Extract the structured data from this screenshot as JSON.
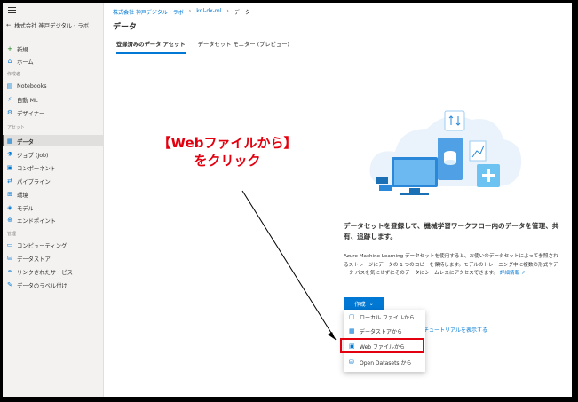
{
  "workspace": {
    "name": "株式会社 神戸デジタル・ラボ"
  },
  "sidebar": {
    "items_top": [
      {
        "label": "新規",
        "icon": "plus-icon"
      },
      {
        "label": "ホーム",
        "icon": "home-icon"
      }
    ],
    "section_author": "作成者",
    "items_author": [
      {
        "label": "Notebooks",
        "icon": "notebook-icon"
      },
      {
        "label": "自動 ML",
        "icon": "automl-icon"
      },
      {
        "label": "デザイナー",
        "icon": "designer-icon"
      }
    ],
    "section_assets": "アセット",
    "items_assets": [
      {
        "label": "データ",
        "icon": "data-icon"
      },
      {
        "label": "ジョブ (Job)",
        "icon": "job-icon"
      },
      {
        "label": "コンポーネント",
        "icon": "component-icon"
      },
      {
        "label": "パイプライン",
        "icon": "pipeline-icon"
      },
      {
        "label": "環境",
        "icon": "environment-icon"
      },
      {
        "label": "モデル",
        "icon": "model-icon"
      },
      {
        "label": "エンドポイント",
        "icon": "endpoint-icon"
      }
    ],
    "section_manage": "管理",
    "items_manage": [
      {
        "label": "コンピューティング",
        "icon": "compute-icon"
      },
      {
        "label": "データストア",
        "icon": "datastore-icon"
      },
      {
        "label": "リンクされたサービス",
        "icon": "linked-service-icon"
      },
      {
        "label": "データのラベル付け",
        "icon": "labeling-icon"
      }
    ]
  },
  "breadcrumb": [
    "株式会社 神戸デジタル・ラボ",
    "kdl-dx-ml",
    "データ"
  ],
  "page": {
    "title": "データ"
  },
  "tabs": [
    "登録済みのデータ アセット",
    "データセット モニター (プレビュー)"
  ],
  "annotation": {
    "line1": "【Webファイルから】",
    "line2": "をクリック"
  },
  "empty_state": {
    "title": "データセットを登録して、機械学習ワークフロー内のデータを管理、共有、追跡します。",
    "description": "Azure Machine Learning データセットを使用すると、お使いのデータセットによって参照されるストレージにデータの 1 つのコピーを保持します。モデルのトレーニング中に複数の形式やデータ パスを気にせずにそのデータにシームレスにアクセスできます。",
    "learn_more": "詳細情報 ↗"
  },
  "create_button": {
    "label": "作成",
    "icon": "chevron-down-icon"
  },
  "background_link": "チュートリアルを表示する",
  "menu": {
    "items": [
      {
        "label": "ローカル ファイルから",
        "icon": "local-file-icon"
      },
      {
        "label": "データストアから",
        "icon": "datastore-icon"
      },
      {
        "label": "Web ファイルから",
        "icon": "web-file-icon"
      },
      {
        "label": "Open Datasets から",
        "icon": "open-datasets-icon"
      }
    ]
  },
  "colors": {
    "accent": "#0078d4",
    "annotation": "#e3000f"
  }
}
